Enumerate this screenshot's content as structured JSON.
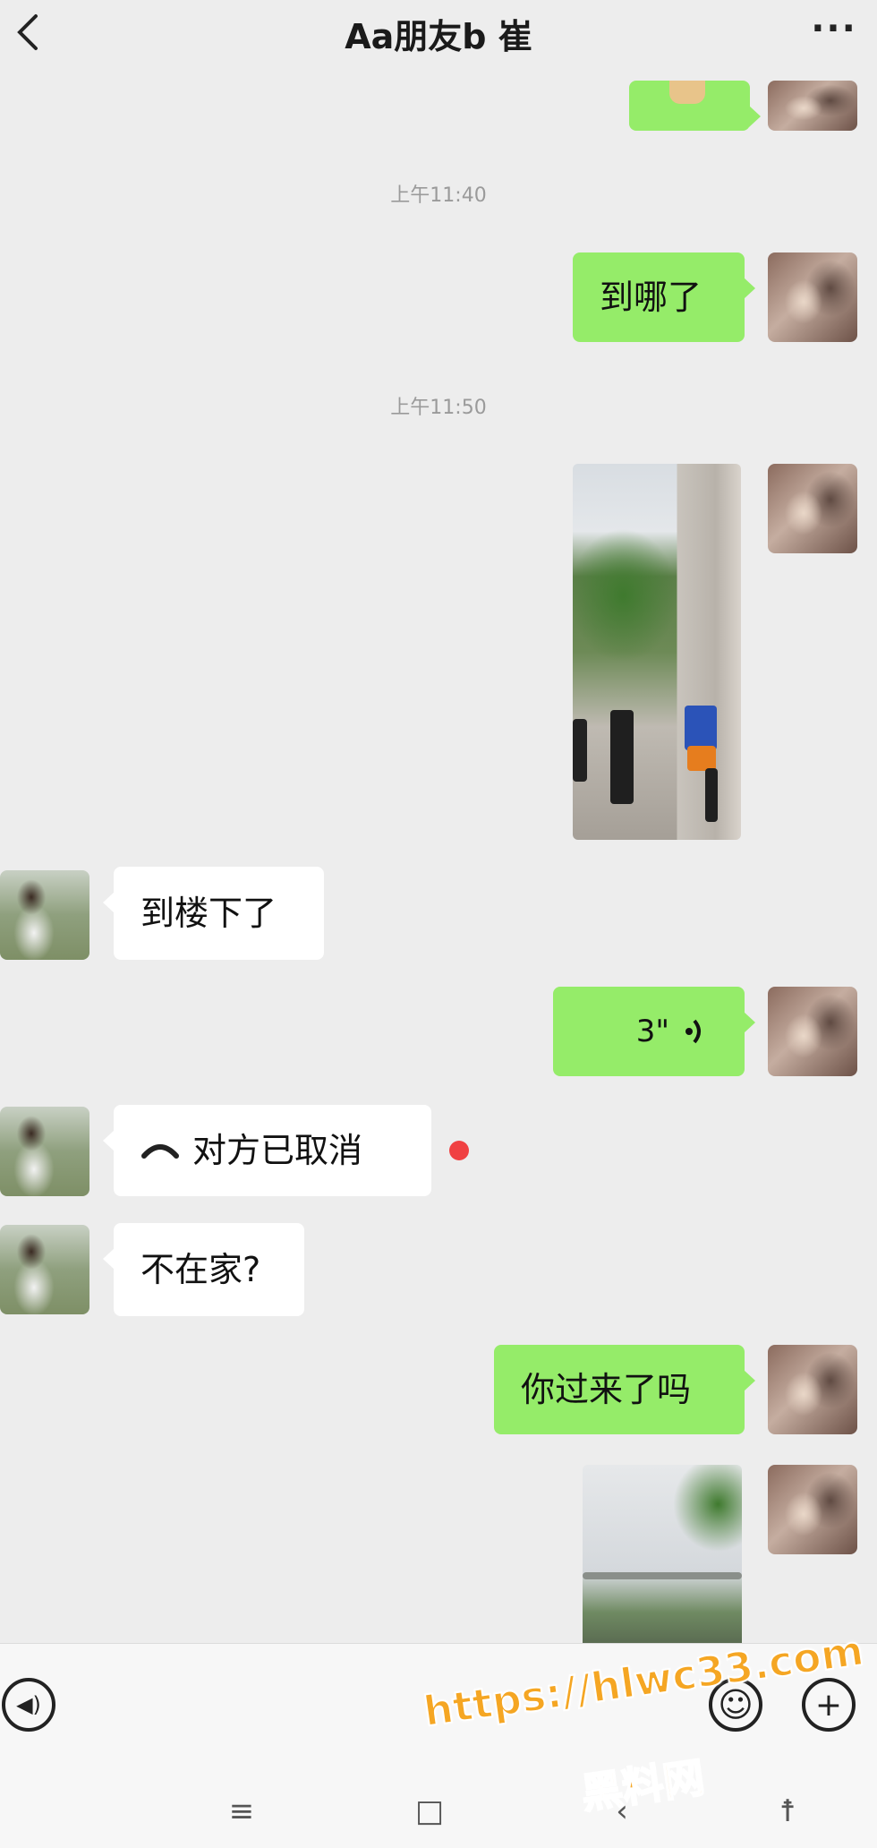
{
  "header": {
    "title": "Aa朋友b 崔",
    "more_label": "···"
  },
  "timestamps": [
    "上午11:40",
    "上午11:50"
  ],
  "messages": {
    "m1": "到哪了",
    "m2": "到楼下了",
    "m3_duration": "3\"",
    "m4": "对方已取消",
    "m5": "不在家?",
    "m6": "你过来了吗"
  },
  "input_bar": {
    "voice_label": "◀)",
    "emoji_label": "☺",
    "plus_label": "+"
  },
  "nav": {
    "menu_label": "≡",
    "home_label": "□",
    "back_label": "‹",
    "accessibility_label": "☨"
  },
  "watermark": {
    "url": "https://hlwc33.com",
    "name": "黑料网"
  },
  "colors": {
    "sent_bubble": "#95ec69",
    "received_bubble": "#ffffff",
    "background": "#ededed",
    "unread_dot": "#f04142",
    "watermark": "#f5a623"
  }
}
